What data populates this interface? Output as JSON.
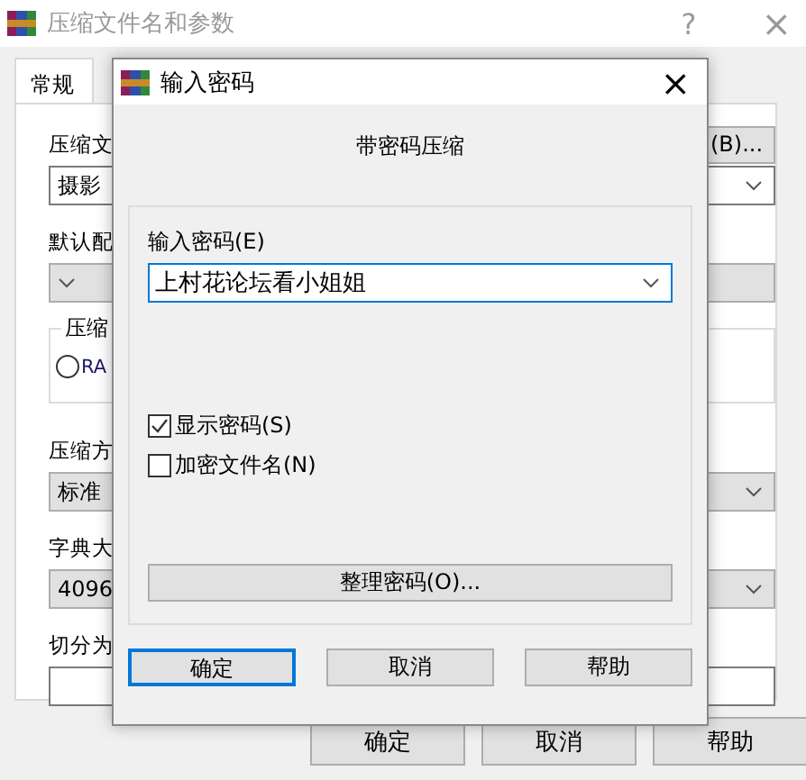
{
  "main_window": {
    "title": "压缩文件名和参数",
    "help": "?",
    "close": "×",
    "tabs": [
      {
        "label": "常规",
        "selected": true
      }
    ],
    "rows": [
      {
        "kind": "combo",
        "label": "压缩文",
        "value": "摄影",
        "button": "(B)...",
        "disabled": false
      },
      {
        "kind": "combo",
        "label": "默认配",
        "disabled": true
      },
      {
        "kind": "group",
        "label": "压缩",
        "option": "RA",
        "selected": false
      },
      {
        "kind": "combo",
        "label": "压缩方",
        "value": "标准",
        "disabled": true
      },
      {
        "kind": "combo",
        "label": "字典大",
        "value": "4096",
        "disabled": true
      },
      {
        "kind": "field",
        "label": "切分为"
      }
    ],
    "buttons": [
      "确定",
      "取消",
      "帮助"
    ]
  },
  "dialog": {
    "title": "输入密码",
    "close": "×",
    "heading": "带密码压缩",
    "password": {
      "label": "输入密码(E)",
      "value": "上村花论坛看小姐姐"
    },
    "options": [
      {
        "label": "显示密码(S)",
        "checked": true
      },
      {
        "label": "加密文件名(N)",
        "checked": false
      }
    ],
    "organize_button": "整理密码(O)...",
    "buttons": [
      {
        "label": "确定",
        "focused": true
      },
      {
        "label": "取消",
        "focused": false
      },
      {
        "label": "帮助",
        "focused": false
      }
    ]
  }
}
